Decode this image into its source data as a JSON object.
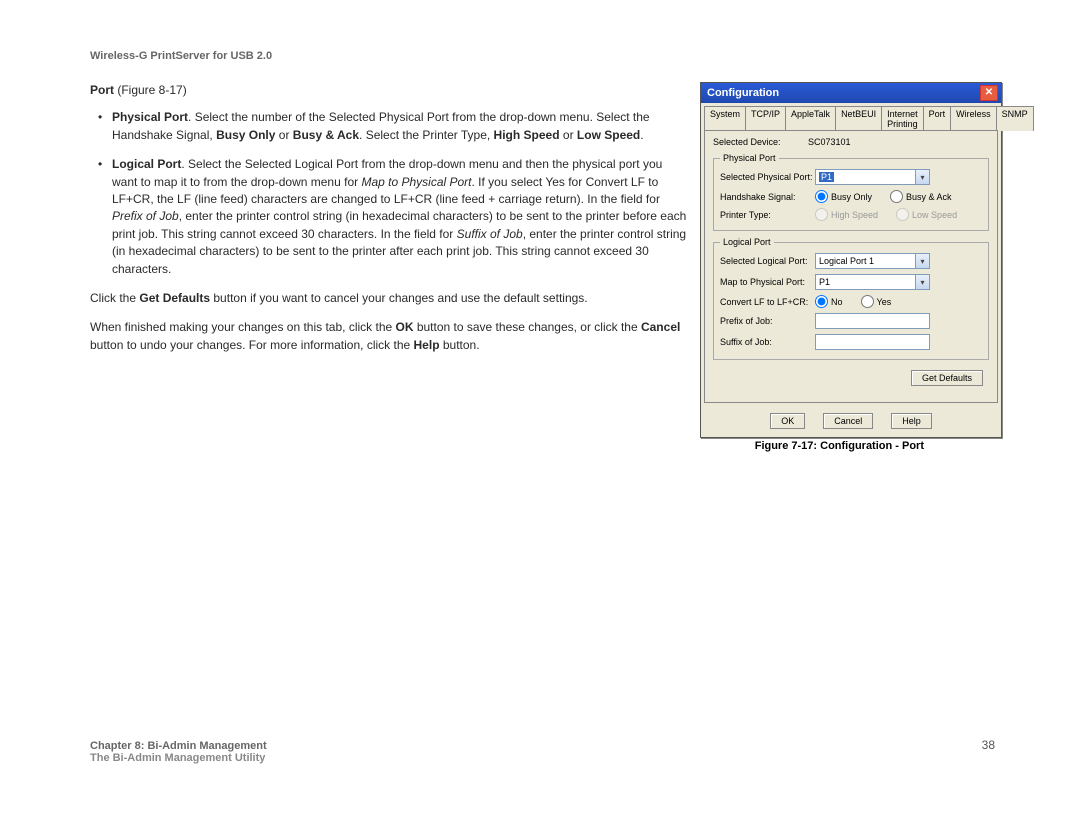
{
  "header": {
    "title": "Wireless-G PrintServer for USB 2.0"
  },
  "body": {
    "port_heading_bold": "Port",
    "port_heading_rest": " (Figure 8-17)",
    "bullet1_lead": "Physical Port",
    "bullet1_text": ". Select the number of the Selected Physical Port from the drop-down menu. Select the Handshake Signal, ",
    "bullet1_b2": "Busy Only",
    "bullet1_mid1": " or ",
    "bullet1_b3": "Busy & Ack",
    "bullet1_mid2": ". Select the Printer Type, ",
    "bullet1_b4": "High Speed",
    "bullet1_mid3": " or ",
    "bullet1_b5": "Low Speed",
    "bullet1_end": ".",
    "bullet2_lead": "Logical Port",
    "bullet2_t1": ". Select the Selected Logical Port from the drop-down menu and then the physical port you want to map it to from the drop-down menu for ",
    "bullet2_i1": "Map to Physical Port",
    "bullet2_t2": ". If you select Yes for Convert LF to LF+CR, the LF (line feed) characters are changed to LF+CR (line feed + carriage return). In the field for ",
    "bullet2_i2": "Prefix of Job",
    "bullet2_t3": ", enter the printer control string (in hexadecimal characters) to be sent to the printer before each print job. This string cannot exceed 30 characters. In the field for ",
    "bullet2_i3": "Suffix of Job",
    "bullet2_t4": ", enter the printer control string (in hexadecimal characters) to be sent to the printer after each print job. This string cannot exceed 30 characters.",
    "para1_a": "Click the ",
    "para1_b": "Get Defaults",
    "para1_c": " button if you want to cancel your changes and use the default settings.",
    "para2_a": "When finished making your changes on this tab, click the ",
    "para2_b": "OK",
    "para2_c": " button to save these changes, or click the ",
    "para2_d": "Cancel",
    "para2_e": " button to undo your changes. For more information, click the ",
    "para2_f": "Help",
    "para2_g": " button."
  },
  "dialog": {
    "title": "Configuration",
    "tabs": [
      "System",
      "TCP/IP",
      "AppleTalk",
      "NetBEUI",
      "Internet Printing",
      "Port",
      "Wireless",
      "SNMP"
    ],
    "selected_device_label": "Selected Device:",
    "selected_device_value": "SC073101",
    "fieldset1": "Physical Port",
    "spp_label": "Selected Physical Port:",
    "spp_value": "P1",
    "hs_label": "Handshake Signal:",
    "hs_opt1": "Busy Only",
    "hs_opt2": "Busy & Ack",
    "pt_label": "Printer Type:",
    "pt_opt1": "High Speed",
    "pt_opt2": "Low Speed",
    "fieldset2": "Logical Port",
    "slp_label": "Selected Logical Port:",
    "slp_value": "Logical Port 1",
    "mpp_label": "Map to Physical Port:",
    "mpp_value": "P1",
    "clf_label": "Convert LF to LF+CR:",
    "clf_no": "No",
    "clf_yes": "Yes",
    "prefix_label": "Prefix of Job:",
    "suffix_label": "Suffix of Job:",
    "get_defaults": "Get Defaults",
    "ok": "OK",
    "cancel": "Cancel",
    "help": "Help"
  },
  "caption": "Figure 7-17: Configuration - Port",
  "footer": {
    "line1": "Chapter 8: Bi-Admin Management",
    "line2": "The Bi-Admin Management Utility",
    "page": "38"
  }
}
